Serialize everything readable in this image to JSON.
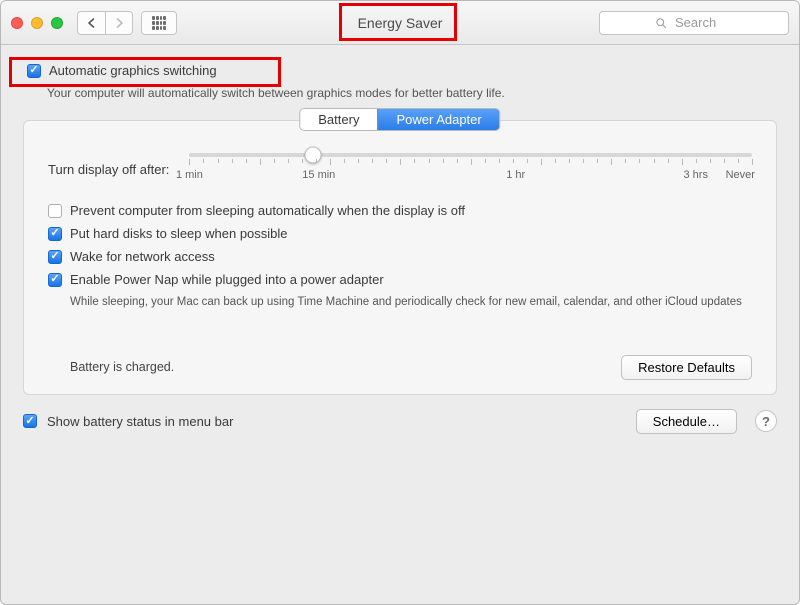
{
  "toolbar": {
    "title": "Energy Saver",
    "search_placeholder": "Search"
  },
  "auto_switch": {
    "label": "Automatic graphics switching",
    "checked": true,
    "note": "Your computer will automatically switch between graphics modes for better battery life."
  },
  "tabs": {
    "battery": "Battery",
    "power_adapter": "Power Adapter",
    "active": "power_adapter"
  },
  "slider": {
    "label": "Turn display off after:",
    "ticks": [
      "1 min",
      "15 min",
      "1 hr",
      "3 hrs",
      "Never"
    ],
    "value_pct": 22
  },
  "options": [
    {
      "checked": false,
      "label": "Prevent computer from sleeping automatically when the display is off"
    },
    {
      "checked": true,
      "label": "Put hard disks to sleep when possible"
    },
    {
      "checked": true,
      "label": "Wake for network access"
    },
    {
      "checked": true,
      "label": "Enable Power Nap while plugged into a power adapter",
      "sub": "While sleeping, your Mac can back up using Time Machine and periodically check for new email, calendar, and other iCloud updates"
    }
  ],
  "status": "Battery is charged.",
  "buttons": {
    "restore_defaults": "Restore Defaults",
    "schedule": "Schedule…"
  },
  "menu_bar": {
    "checked": true,
    "label": "Show battery status in menu bar"
  }
}
